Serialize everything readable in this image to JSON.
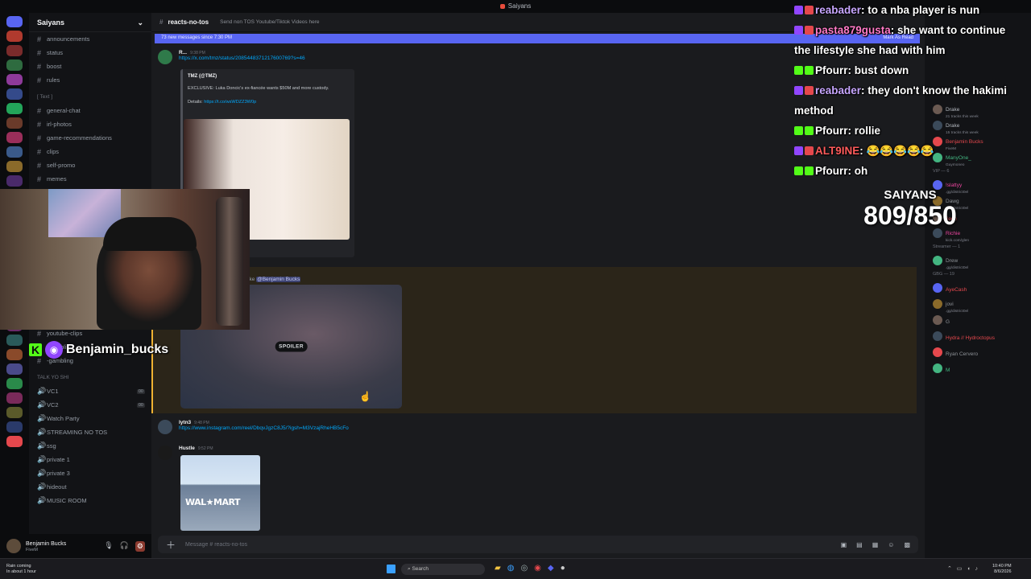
{
  "window": {
    "title": "Saiyans"
  },
  "server": {
    "name": "Saiyans"
  },
  "channels": [
    {
      "label": "announcements",
      "type": "text"
    },
    {
      "label": "status",
      "type": "text"
    },
    {
      "label": "boost",
      "type": "text"
    },
    {
      "label": "rules",
      "type": "text"
    },
    {
      "label": "[ Text ]",
      "type": "category"
    },
    {
      "label": "general-chat",
      "type": "text"
    },
    {
      "label": "irl-photos",
      "type": "text"
    },
    {
      "label": "game-recommendations",
      "type": "text"
    },
    {
      "label": "clips",
      "type": "text"
    },
    {
      "label": "self-promo",
      "type": "text"
    },
    {
      "label": "memes",
      "type": "text"
    }
  ],
  "channels_lower": [
    {
      "label": "youtube-clips",
      "type": "text"
    },
    {
      "label": "-gambling",
      "type": "text"
    },
    {
      "label": "-gambling",
      "type": "text"
    },
    {
      "label": "TALK YO SHI",
      "type": "category"
    },
    {
      "label": "VC1",
      "type": "voice",
      "badge": "00"
    },
    {
      "label": "VC2",
      "type": "voice",
      "badge": "00"
    },
    {
      "label": "Watch Party",
      "type": "voice"
    },
    {
      "label": "STREAMING NO TOS",
      "type": "voice"
    },
    {
      "label": "ssg",
      "type": "voice"
    },
    {
      "label": "private 1",
      "type": "voice"
    },
    {
      "label": "private 3",
      "type": "voice"
    },
    {
      "label": "hideout",
      "type": "voice"
    },
    {
      "label": "MUSIC ROOM",
      "type": "voice"
    }
  ],
  "user_panel": {
    "name": "Benjamin Bucks",
    "status": "FiveM"
  },
  "channel_header": {
    "name": "reacts-no-tos",
    "topic": "Send non TOS Youtube/Tiktok Videos here"
  },
  "new_messages_bar": {
    "text": "73 new messages since 7:30 PM",
    "action": "Mark As Read"
  },
  "messages": {
    "m1": {
      "author": "R...",
      "time": "9:38 PM",
      "link": "https://x.com/tmz/status/2085448371217600769?s=46"
    },
    "embed": {
      "author": "TMZ (@TMZ)",
      "description": "EXCLUSIVE: Luka Doncic's ex-fiancée wants $50M and more custody.",
      "details_label": "Details:",
      "details_link": "https://t.co/wsWDZZ3W0p"
    },
    "mention": {
      "prefix": "ike",
      "user": "@Benjamin Bucks"
    },
    "spoiler_label": "SPOILER",
    "m3": {
      "author": "lytn3",
      "time": "9:48 PM",
      "link": "https://www.instagram.com/reel/DbqvJgzC8J5/?igsh=M3VzajRheHB5cFo"
    },
    "m4": {
      "author": "Hustle",
      "time": "9:52 PM",
      "image_sign": "WAL★MART"
    }
  },
  "composer": {
    "placeholder": "Message # reacts-no-tos"
  },
  "member_list": [
    {
      "name": "Drake",
      "sub": "21 tracks this week",
      "color": "#b5bac1"
    },
    {
      "name": "Drake",
      "sub": "15 tracks this week",
      "color": "#b5bac1"
    },
    {
      "name": "Benjamin Bucks",
      "sub": "FiveM",
      "color": "#e5484d"
    },
    {
      "name": "ManyOne_",
      "sub": "Guymoneo",
      "color": "#43b581"
    },
    {
      "name": "VIP — 6",
      "sub": "",
      "color": "#6d717a",
      "category": true
    },
    {
      "name": "!slattyy",
      "sub": ".gg/district0el",
      "color": "#eb459f"
    },
    {
      "name": "Dawg",
      "sub": ".gg/district0el",
      "color": "#8e9297"
    },
    {
      "name": "Jerin",
      "sub": "",
      "color": "#e5484d"
    },
    {
      "name": "Richie",
      "sub": "kick.com/glen",
      "color": "#eb459f"
    },
    {
      "name": "Streamer — 1",
      "sub": "",
      "color": "#6d717a",
      "category": true
    },
    {
      "name": "Drew",
      "sub": ".gg/district0el",
      "color": "#8e9297"
    },
    {
      "name": "GBG — 19",
      "sub": "",
      "color": "#6d717a",
      "category": true
    },
    {
      "name": "AyeCash",
      "sub": "",
      "color": "#e5484d"
    },
    {
      "name": "jovi",
      "sub": ".gg/district0el",
      "color": "#8e9297"
    },
    {
      "name": "G",
      "sub": "",
      "color": "#8e9297"
    },
    {
      "name": "Hydra // Hydroctopus",
      "sub": "",
      "color": "#e5484d"
    },
    {
      "name": "Ryan Cervero",
      "sub": "",
      "color": "#8e9297"
    },
    {
      "name": "M",
      "sub": "",
      "color": "#43b581"
    }
  ],
  "chat_overlay": [
    {
      "user": "reabader",
      "text": "to a nba player is nun",
      "color": "#c7a6ff"
    },
    {
      "user": "pasta879gusta",
      "text": "she want to continue the lifestyle she had with him",
      "color": "#ff7ac6"
    },
    {
      "user": "Pfourr",
      "text": "bust down",
      "color": "#ffffff"
    },
    {
      "user": "reabader",
      "text": "they don't know the hakimi method",
      "color": "#c7a6ff"
    },
    {
      "user": "Pfourr",
      "text": "rollie",
      "color": "#ffffff"
    },
    {
      "user": "ALT9INE",
      "text": "😂😂😂😂😂",
      "color": "#ff5b5b"
    },
    {
      "user": "Pfourr",
      "text": "oh",
      "color": "#ffffff"
    }
  ],
  "goal": {
    "label": "SAIYANS",
    "value": "809/850"
  },
  "stream_sticker": {
    "name": "Benjamin_bucks"
  },
  "taskbar": {
    "weather_1": "Rain coming",
    "weather_2": "In about 1 hour",
    "search": "Search",
    "time": "10:40 PM",
    "date": "8/6/2026"
  },
  "colors": {
    "accent": "#5865f2",
    "mention": "#f0b232",
    "link": "#00a8fc"
  }
}
